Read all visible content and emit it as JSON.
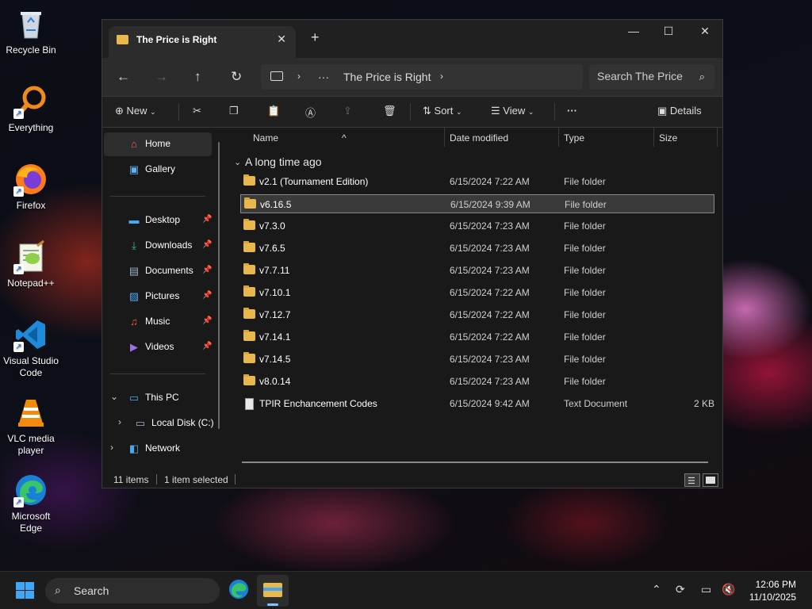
{
  "desktop": {
    "icons": [
      {
        "label": "Recycle Bin",
        "icon": "recycle-bin-icon"
      },
      {
        "label": "Everything",
        "icon": "everything-icon"
      },
      {
        "label": "Firefox",
        "icon": "firefox-icon"
      },
      {
        "label": "Notepad++",
        "icon": "notepad-plus-plus-icon"
      },
      {
        "label": "Visual Studio Code",
        "icon": "vscode-icon"
      },
      {
        "label": "VLC media player",
        "icon": "vlc-icon"
      },
      {
        "label": "Microsoft Edge",
        "icon": "edge-icon"
      }
    ]
  },
  "window": {
    "tab_title": "The Price is Right",
    "new_tab": "+",
    "controls": {
      "minimize": "—",
      "maximize": "☐",
      "close": "✕"
    }
  },
  "nav": {
    "back": "←",
    "forward": "→",
    "up": "↑",
    "refresh": "↻",
    "breadcrumb_more": "···",
    "breadcrumb_current": "The Price is Right",
    "search_placeholder": "Search The Price"
  },
  "toolbar": {
    "new_label": "New",
    "sort_label": "Sort",
    "view_label": "View",
    "more": "···",
    "details_label": "Details"
  },
  "sidebar": {
    "home": "Home",
    "gallery": "Gallery",
    "quick_access": [
      {
        "label": "Desktop",
        "icon": "desktop-icon"
      },
      {
        "label": "Downloads",
        "icon": "downloads-icon"
      },
      {
        "label": "Documents",
        "icon": "documents-icon"
      },
      {
        "label": "Pictures",
        "icon": "pictures-icon"
      },
      {
        "label": "Music",
        "icon": "music-icon"
      },
      {
        "label": "Videos",
        "icon": "videos-icon"
      }
    ],
    "this_pc": "This PC",
    "local_disk": "Local Disk (C:)",
    "network": "Network"
  },
  "columns": {
    "name": "Name",
    "date": "Date modified",
    "type": "Type",
    "size": "Size"
  },
  "group": {
    "title": "A long time ago"
  },
  "files": [
    {
      "name": "v2.1 (Tournament Edition)",
      "date": "6/15/2024 7:22 AM",
      "type": "File folder",
      "size": "",
      "kind": "folder",
      "selected": false
    },
    {
      "name": "v6.16.5",
      "date": "6/15/2024 9:39 AM",
      "type": "File folder",
      "size": "",
      "kind": "folder",
      "selected": true
    },
    {
      "name": "v7.3.0",
      "date": "6/15/2024 7:23 AM",
      "type": "File folder",
      "size": "",
      "kind": "folder",
      "selected": false
    },
    {
      "name": "v7.6.5",
      "date": "6/15/2024 7:23 AM",
      "type": "File folder",
      "size": "",
      "kind": "folder",
      "selected": false
    },
    {
      "name": "v7.7.11",
      "date": "6/15/2024 7:23 AM",
      "type": "File folder",
      "size": "",
      "kind": "folder",
      "selected": false
    },
    {
      "name": "v7.10.1",
      "date": "6/15/2024 7:22 AM",
      "type": "File folder",
      "size": "",
      "kind": "folder",
      "selected": false
    },
    {
      "name": "v7.12.7",
      "date": "6/15/2024 7:22 AM",
      "type": "File folder",
      "size": "",
      "kind": "folder",
      "selected": false
    },
    {
      "name": "v7.14.1",
      "date": "6/15/2024 7:22 AM",
      "type": "File folder",
      "size": "",
      "kind": "folder",
      "selected": false
    },
    {
      "name": "v7.14.5",
      "date": "6/15/2024 7:23 AM",
      "type": "File folder",
      "size": "",
      "kind": "folder",
      "selected": false
    },
    {
      "name": "v8.0.14",
      "date": "6/15/2024 7:23 AM",
      "type": "File folder",
      "size": "",
      "kind": "folder",
      "selected": false
    },
    {
      "name": "TPIR Enchancement Codes",
      "date": "6/15/2024 9:42 AM",
      "type": "Text Document",
      "size": "2 KB",
      "kind": "text",
      "selected": false
    }
  ],
  "status": {
    "items": "11 items",
    "selected": "1 item selected"
  },
  "taskbar": {
    "search_label": "Search",
    "time": "12:06 PM",
    "date": "11/10/2025"
  },
  "colors": {
    "accent": "#3fa7f5",
    "folder": "#e8b84d",
    "selection_border": "#8a8a8a"
  }
}
